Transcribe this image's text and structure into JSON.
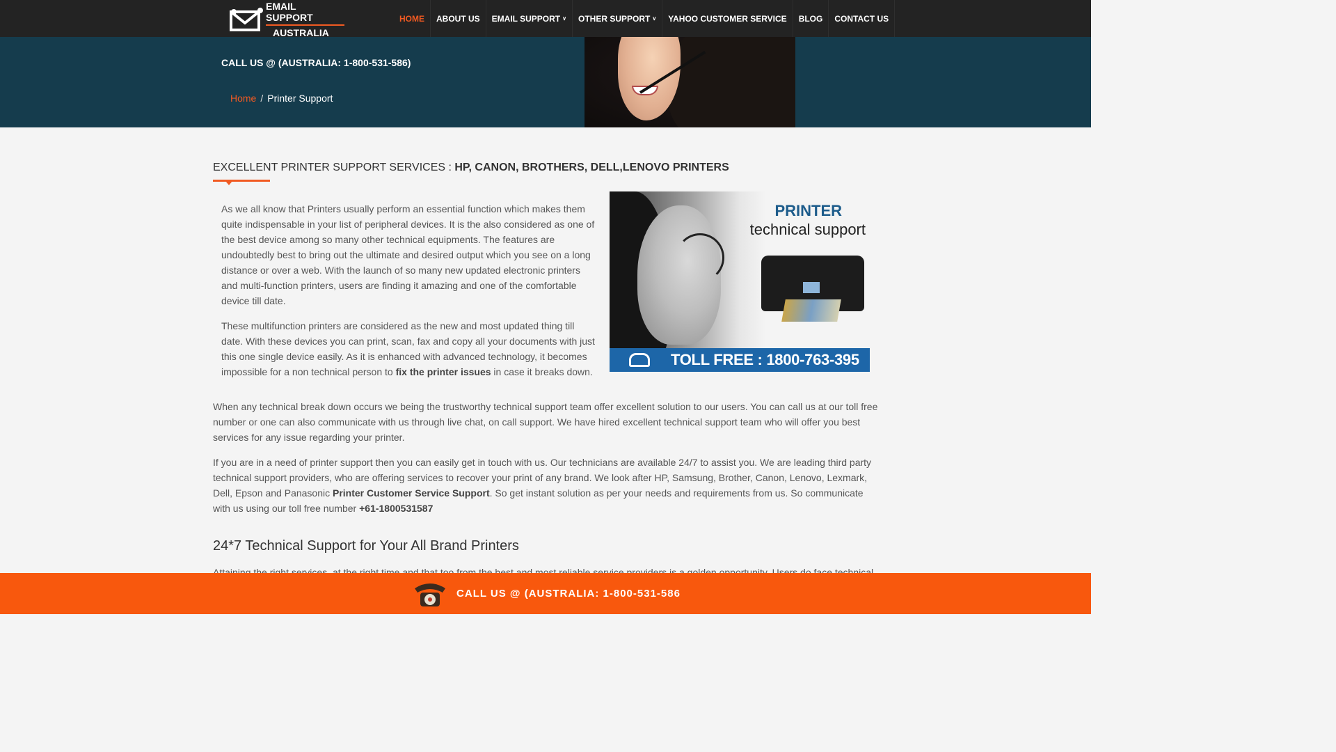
{
  "logo": {
    "line1": "EMAIL SUPPORT",
    "line2": "AUSTRALIA"
  },
  "nav": [
    {
      "label": "HOME",
      "active": true
    },
    {
      "label": "ABOUT US"
    },
    {
      "label": "EMAIL SUPPORT",
      "dropdown": true
    },
    {
      "label": "OTHER SUPPORT",
      "dropdown": true
    },
    {
      "label": "YAHOO CUSTOMER SERVICE"
    },
    {
      "label": "BLOG"
    },
    {
      "label": "CONTACT US"
    }
  ],
  "banner": {
    "call": "CALL US @ (AUSTRALIA: 1-800-531-586)",
    "breadcrumb_home": "Home",
    "breadcrumb_sep": "/",
    "breadcrumb_current": "Printer Support"
  },
  "section": {
    "title_normal": "EXCELLENT PRINTER SUPPORT SERVICES : ",
    "title_bold": "HP, CANON, BROTHERS, DELL,LENOVO PRINTERS"
  },
  "paragraphs": {
    "p1": "As we all know that Printers usually perform an essential function which makes them quite indispensable in your list of peripheral devices. It is the also considered as one of the best device among so many other technical equipments. The features are undoubtedly best to bring out the ultimate and desired output which you see on a long distance or over a web. With the launch of so many new updated electronic printers and multi-function printers, users are finding it amazing and one of the comfortable device till date.",
    "p2_a": "These multifunction printers are considered as the new and most updated thing till date. With these devices you can print, scan, fax and copy all your documents with just this one single device easily. As it is enhanced with advanced technology, it becomes impossible for a non technical person to ",
    "p2_b": "fix the printer issues",
    "p2_c": " in case it breaks down.",
    "p3": "When any technical break down occurs we being the trustworthy technical support team offer excellent solution to our users. You can call us at our toll free number or one can also communicate with us through live chat, on call support. We have hired excellent technical support team who will offer you best services for any issue regarding your printer.",
    "p4_a": "If you are in a need of printer support then you can easily get in touch with us. Our technicians are available 24/7 to assist you. We are leading third party technical support providers, who are offering services to recover your print of any brand. We look after HP, Samsung, Brother, Canon, Lenovo, Lexmark, Dell, Epson and Panasonic ",
    "p4_b": "Printer Customer Service Support",
    "p4_c": ". So get instant solution as per your needs and requirements from us. So communicate with us using our toll free number ",
    "p4_d": "+61-1800531587",
    "h2": "24*7 Technical Support for Your All Brand Printers",
    "p5": "Attaining the right services, at the right time and that too from the best and most reliable service providers is a golden opportunity. Users do face technical"
  },
  "promo": {
    "title1": "PRINTER",
    "title2": "technical support",
    "tollfree": "TOLL FREE : 1800-763-395"
  },
  "callbar": {
    "text": "CALL US @ (AUSTRALIA: 1-800-531-586"
  },
  "colors": {
    "accent": "#f15a22",
    "banner": "#153c4d",
    "topbar": "#232323",
    "callbar": "#f8580d",
    "promo_bar": "#1d66a8"
  }
}
